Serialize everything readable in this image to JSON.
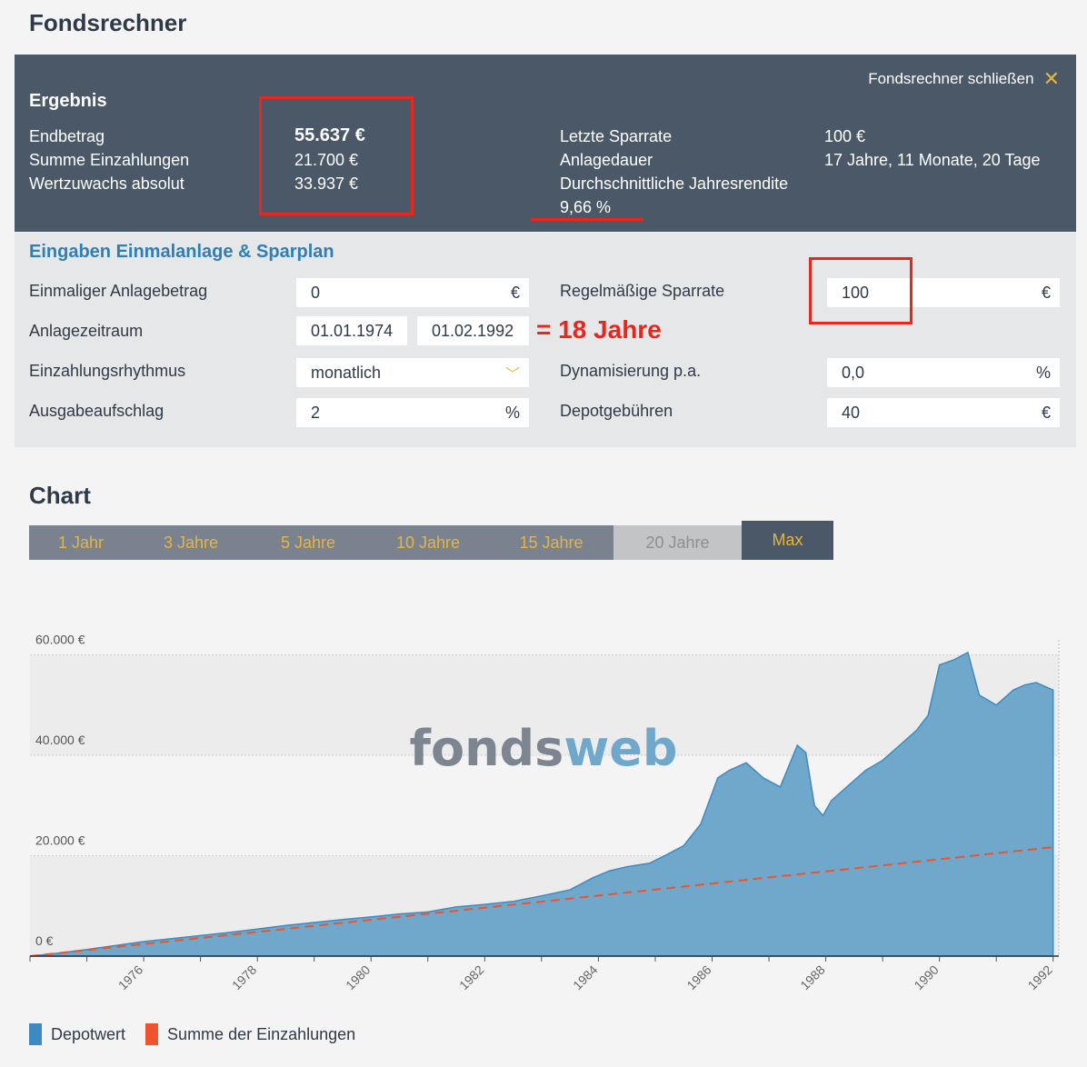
{
  "page_title": "Fondsrechner",
  "result": {
    "close_label": "Fondsrechner schließen",
    "close_icon": "close-icon",
    "heading": "Ergebnis",
    "endbetrag_label": "Endbetrag",
    "endbetrag_value": "55.637 €",
    "einzahlungen_label": "Summe Einzahlungen",
    "einzahlungen_value": "21.700 €",
    "wertzuwachs_label": "Wertzuwachs absolut",
    "wertzuwachs_value": "33.937 €",
    "sparrate_label": "Letzte Sparrate",
    "sparrate_value": "100 €",
    "dauer_label": "Anlagedauer",
    "dauer_value": "17 Jahre, 11 Monate, 20 Tage",
    "rendite_label": "Durchschnittliche Jahresrendite",
    "rendite_value": "9,66 %"
  },
  "inputs": {
    "heading": "Eingaben Einmalanlage & Sparplan",
    "einmal_label": "Einmaliger Anlagebetrag",
    "einmal_value": "0",
    "einmal_unit": "€",
    "zeitraum_label": "Anlagezeitraum",
    "zeitraum_start": "01.01.1974",
    "zeitraum_end": "01.02.1992",
    "zeitraum_annotation": "= 18 Jahre",
    "rhythmus_label": "Einzahlungsrhythmus",
    "rhythmus_value": "monatlich",
    "aufschlag_label": "Ausgabeaufschlag",
    "aufschlag_value": "2",
    "aufschlag_unit": "%",
    "sparrate_label": "Regelmäßige Sparrate",
    "sparrate_value": "100",
    "sparrate_unit": "€",
    "dynamik_label": "Dynamisierung p.a.",
    "dynamik_value": "0,0",
    "dynamik_unit": "%",
    "depot_label": "Depotgebühren",
    "depot_value": "40",
    "depot_unit": "€"
  },
  "chart_section": {
    "title": "Chart",
    "tabs": [
      "1 Jahr",
      "3 Jahre",
      "5 Jahre",
      "10 Jahre",
      "15 Jahre",
      "20 Jahre",
      "Max"
    ],
    "active_tab": "Max",
    "disabled_tab": "20 Jahre",
    "watermark_part1": "fonds",
    "watermark_part2": "web"
  },
  "colors": {
    "depot_fill": "#6fa8cb",
    "depot_stroke": "#3d8ac2",
    "einzahlung_line": "#f0522b",
    "annotation_red": "#e8261b",
    "accent_yellow": "#e8b53c"
  },
  "chart_data": {
    "type": "area",
    "y_tick_labels": [
      "0 €",
      "20.000 €",
      "40.000 €",
      "60.000 €"
    ],
    "ylim": [
      0,
      63000
    ],
    "xlim": [
      1974,
      1992.1
    ],
    "x_ticks": [
      1976,
      1978,
      1980,
      1982,
      1984,
      1986,
      1988,
      1990,
      1992
    ],
    "legend": [
      "Depotwert",
      "Summe der Einzahlungen"
    ],
    "grid": true,
    "series": [
      {
        "name": "Depotwert",
        "type": "area",
        "x": [
          1974.0,
          1974.5,
          1975.0,
          1975.5,
          1976.0,
          1976.5,
          1977.0,
          1977.5,
          1978.0,
          1978.5,
          1979.0,
          1979.5,
          1980.0,
          1980.5,
          1981.0,
          1981.5,
          1982.0,
          1982.5,
          1983.0,
          1983.5,
          1983.9,
          1984.2,
          1984.5,
          1984.9,
          1985.2,
          1985.5,
          1985.8,
          1986.1,
          1986.3,
          1986.6,
          1986.9,
          1987.2,
          1987.5,
          1987.65,
          1987.8,
          1987.95,
          1988.1,
          1988.4,
          1988.7,
          1989.0,
          1989.3,
          1989.6,
          1989.8,
          1990.0,
          1990.25,
          1990.5,
          1990.7,
          1991.0,
          1991.3,
          1991.5,
          1991.7,
          1992.0
        ],
        "values": [
          0,
          600,
          1300,
          2100,
          2900,
          3500,
          4100,
          4700,
          5400,
          6100,
          6700,
          7300,
          7800,
          8400,
          8800,
          9800,
          10300,
          10900,
          12000,
          13200,
          15600,
          17000,
          17800,
          18500,
          20200,
          22000,
          26300,
          35500,
          37000,
          38500,
          35500,
          33700,
          42000,
          40500,
          30000,
          28000,
          31000,
          34000,
          37000,
          39000,
          42000,
          45000,
          48000,
          58000,
          59000,
          60500,
          52000,
          50000,
          53000,
          54000,
          54500,
          53000
        ]
      },
      {
        "name": "Summe der Einzahlungen",
        "type": "line",
        "style": "dashed",
        "x": [
          1974.0,
          1992.0
        ],
        "values": [
          0,
          21700
        ]
      }
    ]
  }
}
